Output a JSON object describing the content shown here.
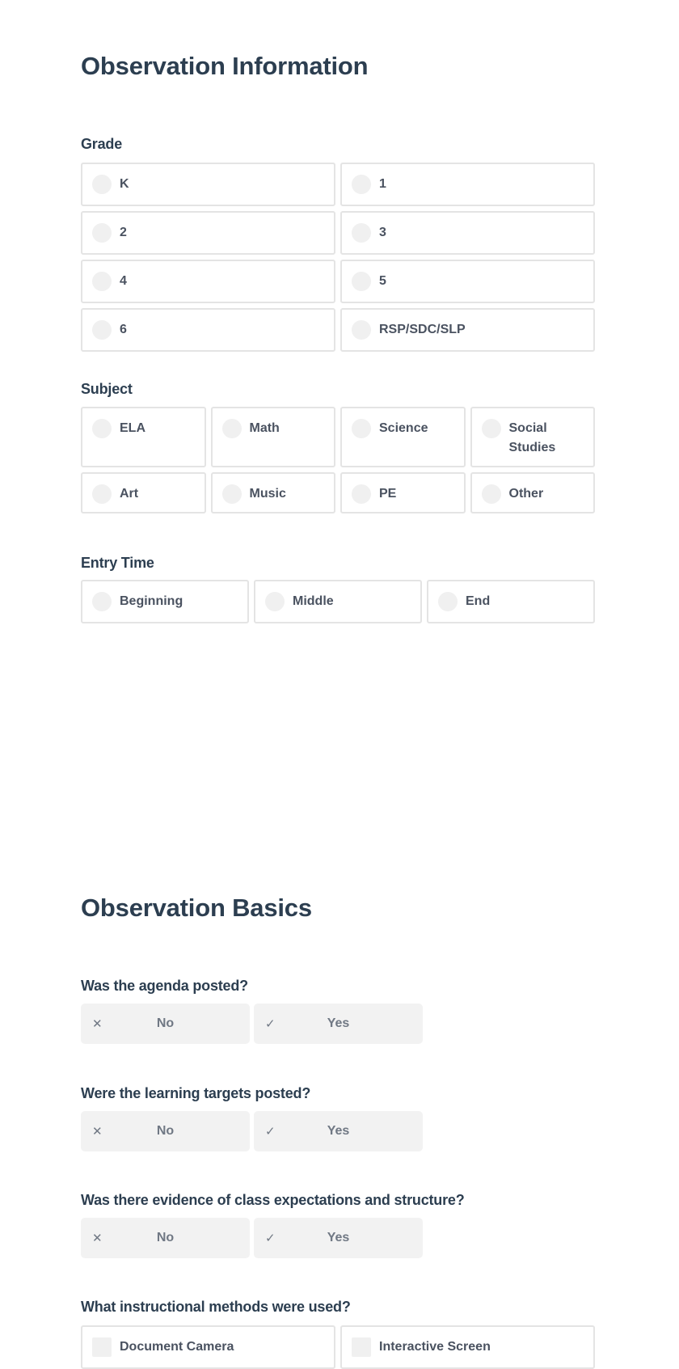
{
  "observation_information": {
    "title": "Observation Information",
    "grade": {
      "label": "Grade",
      "options": [
        "K",
        "1",
        "2",
        "3",
        "4",
        "5",
        "6",
        "RSP/SDC/SLP"
      ]
    },
    "subject": {
      "label": "Subject",
      "options": [
        "ELA",
        "Math",
        "Science",
        "Social Studies",
        "Art",
        "Music",
        "PE",
        "Other"
      ]
    },
    "entry_time": {
      "label": "Entry Time",
      "options": [
        "Beginning",
        "Middle",
        "End"
      ]
    }
  },
  "observation_basics": {
    "title": "Observation Basics",
    "questions": [
      {
        "label": "Was the agenda posted?",
        "no": "No",
        "yes": "Yes"
      },
      {
        "label": "Were the learning targets posted?",
        "no": "No",
        "yes": "Yes"
      },
      {
        "label": "Was there evidence of class expectations and structure?",
        "no": "No",
        "yes": "Yes"
      }
    ],
    "methods": {
      "label": "What instructional methods were used?",
      "options": [
        "Document Camera",
        "Interactive Screen"
      ]
    },
    "icons": {
      "no": "close-icon",
      "yes": "check-icon"
    }
  }
}
